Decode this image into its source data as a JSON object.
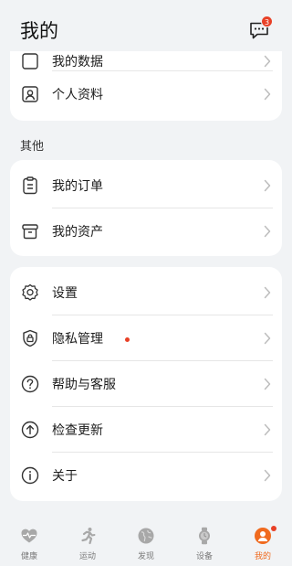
{
  "header": {
    "title": "我的",
    "message_badge": "3"
  },
  "cards": {
    "top": {
      "partial_label": "我的数据",
      "profile_label": "个人资料"
    },
    "other": {
      "section_title": "其他",
      "orders_label": "我的订单",
      "assets_label": "我的资产"
    },
    "settings": {
      "settings_label": "设置",
      "privacy_label": "隐私管理",
      "help_label": "帮助与客服",
      "update_label": "检查更新",
      "about_label": "关于"
    }
  },
  "tabbar": {
    "tabs": [
      {
        "label": "健康",
        "icon": "heart-icon"
      },
      {
        "label": "运动",
        "icon": "runner-icon"
      },
      {
        "label": "发现",
        "icon": "globe-icon"
      },
      {
        "label": "设备",
        "icon": "watch-icon"
      },
      {
        "label": "我的",
        "icon": "avatar-icon",
        "active": true
      }
    ]
  },
  "colors": {
    "accent": "#f06a1e",
    "badge": "#e84026",
    "background": "#f1f3f5",
    "card": "#ffffff"
  }
}
